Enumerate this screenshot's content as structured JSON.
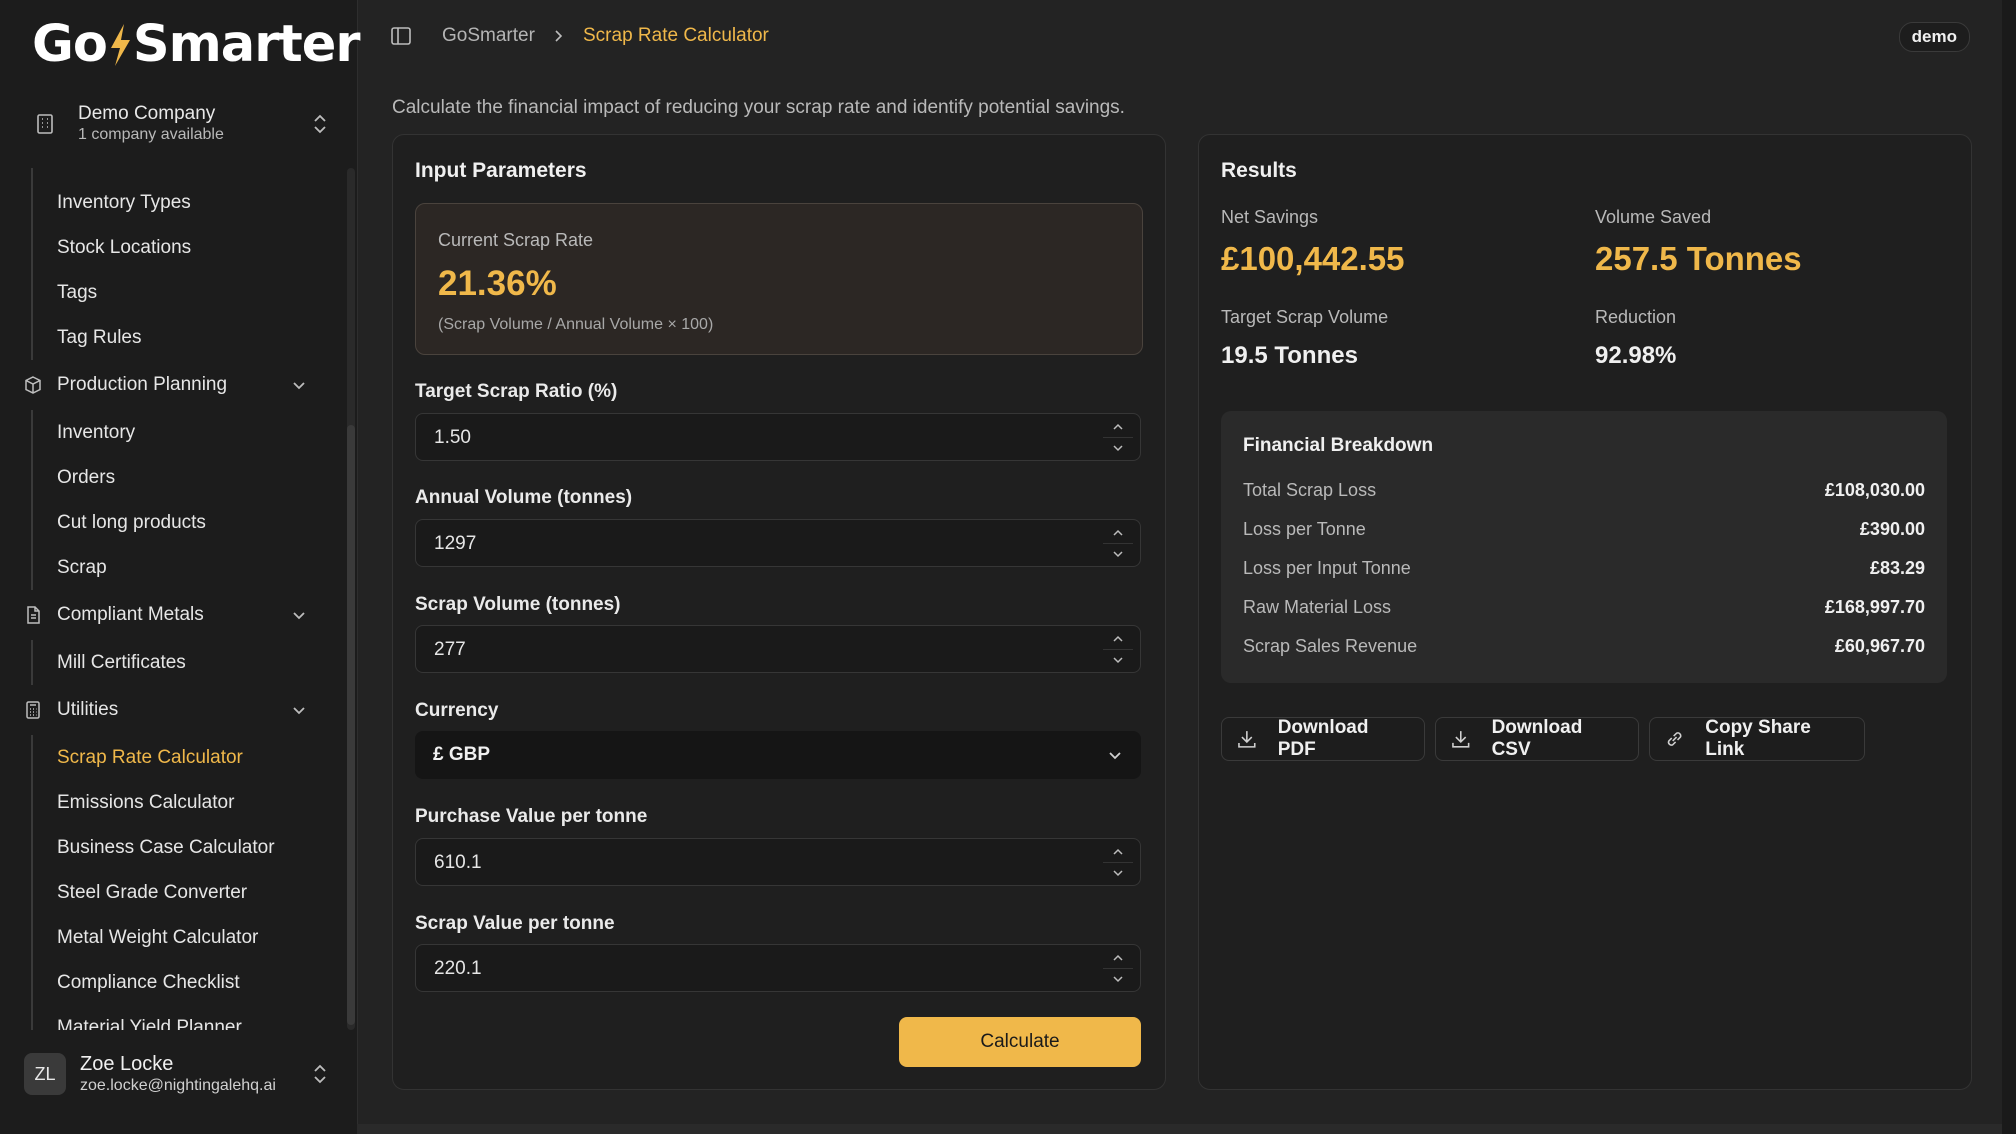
{
  "app": {
    "name": "GoSmarter"
  },
  "company": {
    "name": "Demo Company",
    "subtitle": "1 company available"
  },
  "sidebar": {
    "top_items": [
      "Inventory Types",
      "Stock Locations",
      "Tags",
      "Tag Rules"
    ],
    "sections": [
      {
        "label": "Production Planning",
        "items": [
          "Inventory",
          "Orders",
          "Cut long products",
          "Scrap"
        ]
      },
      {
        "label": "Compliant Metals",
        "items": [
          "Mill Certificates"
        ]
      },
      {
        "label": "Utilities",
        "items": [
          "Scrap Rate Calculator",
          "Emissions Calculator",
          "Business Case Calculator",
          "Steel Grade Converter",
          "Metal Weight Calculator",
          "Compliance Checklist",
          "Material Yield Planner"
        ]
      }
    ]
  },
  "user": {
    "initials": "ZL",
    "name": "Zoe Locke",
    "email": "zoe.locke@nightingalehq.ai"
  },
  "header": {
    "breadcrumb_root": "GoSmarter",
    "breadcrumb_current": "Scrap Rate Calculator",
    "badge": "demo"
  },
  "page": {
    "description": "Calculate the financial impact of reducing your scrap rate and identify potential savings."
  },
  "inputs": {
    "title": "Input Parameters",
    "current_scrap": {
      "label": "Current Scrap Rate",
      "value": "21.36%",
      "formula": "(Scrap Volume / Annual Volume × 100)"
    },
    "target_ratio": {
      "label": "Target Scrap Ratio (%)",
      "value": "1.50"
    },
    "annual_volume": {
      "label": "Annual Volume (tonnes)",
      "value": "1297"
    },
    "scrap_volume": {
      "label": "Scrap Volume (tonnes)",
      "value": "277"
    },
    "currency": {
      "label": "Currency",
      "value": "£ GBP"
    },
    "purchase_value": {
      "label": "Purchase Value per tonne",
      "value": "610.1"
    },
    "scrap_value": {
      "label": "Scrap Value per tonne",
      "value": "220.1"
    },
    "calculate_label": "Calculate"
  },
  "results": {
    "title": "Results",
    "net_savings": {
      "label": "Net Savings",
      "value": "£100,442.55"
    },
    "volume_saved": {
      "label": "Volume Saved",
      "value": "257.5 Tonnes"
    },
    "target_scrap_volume": {
      "label": "Target Scrap Volume",
      "value": "19.5 Tonnes"
    },
    "reduction": {
      "label": "Reduction",
      "value": "92.98%"
    },
    "breakdown": {
      "title": "Financial Breakdown",
      "rows": [
        {
          "label": "Total Scrap Loss",
          "value": "£108,030.00"
        },
        {
          "label": "Loss per Tonne",
          "value": "£390.00"
        },
        {
          "label": "Loss per Input Tonne",
          "value": "£83.29"
        },
        {
          "label": "Raw Material Loss",
          "value": "£168,997.70"
        },
        {
          "label": "Scrap Sales Revenue",
          "value": "£60,967.70"
        }
      ]
    },
    "actions": {
      "pdf": "Download PDF",
      "csv": "Download CSV",
      "share": "Copy Share Link"
    }
  },
  "colors": {
    "accent": "#f0b84a",
    "background": "#232323",
    "sidebar": "#1c1c1c",
    "card": "#1f1f1f"
  }
}
